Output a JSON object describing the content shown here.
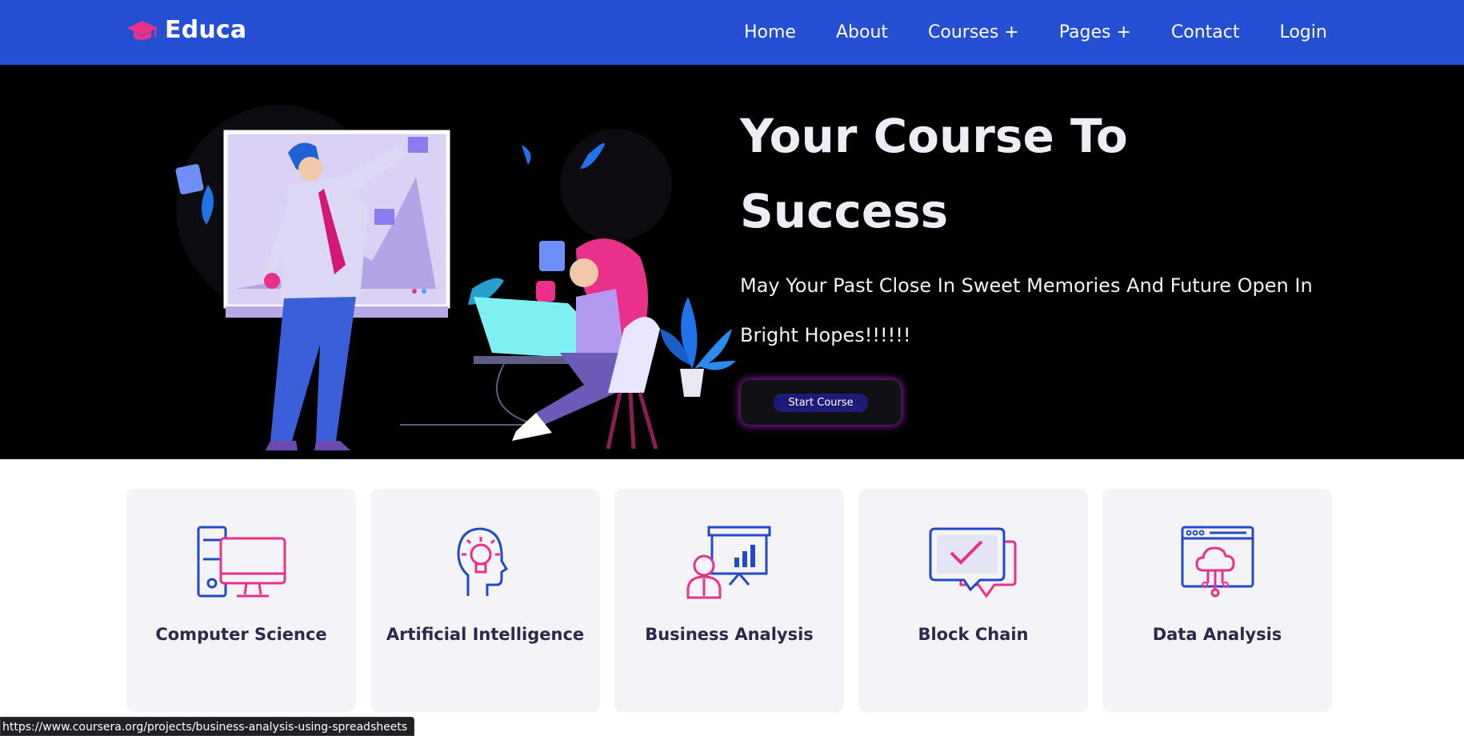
{
  "navbar": {
    "brand": "Educa",
    "brand_icon": "graduation-cap-icon",
    "colors": {
      "background": "#244fd3",
      "brand_icon": "#e9318a"
    },
    "links": [
      "Home",
      "About",
      "Courses +",
      "Pages +",
      "Contact",
      "Login"
    ]
  },
  "hero": {
    "title_line1": "Your Course To",
    "title_line2": "Success",
    "subtitle_line1": "May Your Past Close In Sweet Memories And Future Open In",
    "subtitle_line2": "Bright Hopes!!!!!!",
    "button_label": "Start Course",
    "colors": {
      "background": "#000000",
      "button_glow": "#be28dc"
    }
  },
  "courses": [
    {
      "title": "Computer Science",
      "icon": "computer-icon"
    },
    {
      "title": "Artificial Intelligence",
      "icon": "brain-bulb-icon"
    },
    {
      "title": "Business Analysis",
      "icon": "presentation-chart-icon"
    },
    {
      "title": "Block Chain",
      "icon": "chat-check-icon"
    },
    {
      "title": "Data Analysis",
      "icon": "cloud-network-icon"
    }
  ],
  "statusbar": {
    "url": "https://www.coursera.org/projects/business-analysis-using-spreadsheets"
  }
}
